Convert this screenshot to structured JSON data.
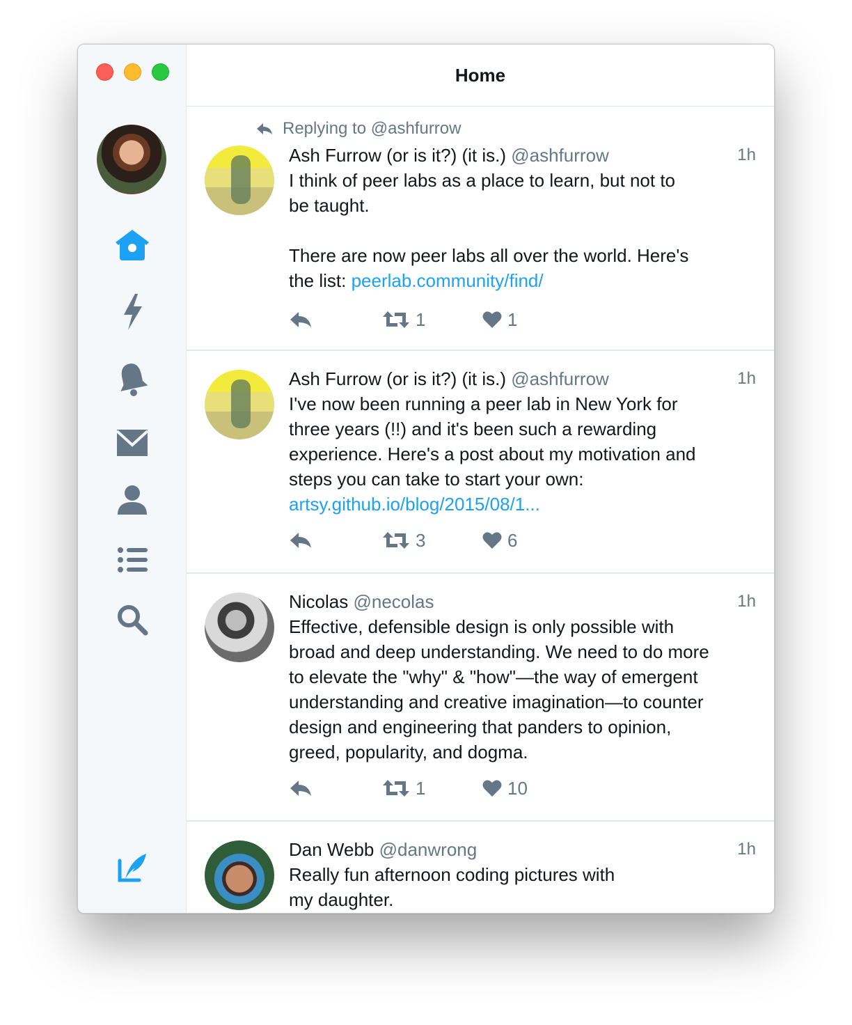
{
  "window": {
    "title": "Home"
  },
  "sidebar": {
    "items": [
      {
        "name": "home",
        "icon": "home-icon",
        "active": true
      },
      {
        "name": "moments",
        "icon": "lightning-icon"
      },
      {
        "name": "notifications",
        "icon": "bell-icon"
      },
      {
        "name": "messages",
        "icon": "envelope-icon"
      },
      {
        "name": "profile",
        "icon": "person-icon"
      },
      {
        "name": "lists",
        "icon": "list-icon"
      },
      {
        "name": "search",
        "icon": "search-icon"
      }
    ],
    "compose_icon": "compose-icon"
  },
  "colors": {
    "accent": "#1da1f2",
    "icon_gray": "#657786",
    "text": "#14171a"
  },
  "tweets": [
    {
      "reply_context": "Replying to @ashfurrow",
      "name": "Ash Furrow (or is it?) (it is.)",
      "handle": "@ashfurrow",
      "time": "1h",
      "text": "I think of peer labs as a place to learn, but not to\nbe taught.\n\nThere are now peer labs all over the world. Here's\nthe list: ",
      "link": "peerlab.community/find/",
      "retweets": "1",
      "likes": "1"
    },
    {
      "name": "Ash Furrow (or is it?) (it is.)",
      "handle": "@ashfurrow",
      "time": "1h",
      "text": "I've now been running a peer lab in New York for\nthree years (!!) and it's been such a rewarding\nexperience. Here's a post about my motivation and\nsteps you can take to start your own:\n",
      "link": "artsy.github.io/blog/2015/08/1...",
      "retweets": "3",
      "likes": "6"
    },
    {
      "name": "Nicolas",
      "handle": "@necolas",
      "time": "1h",
      "text": "Effective, defensible design is only possible with\nbroad and deep understanding. We need to do more\nto elevate the \"why\" & \"how\"—the way of emergent\nunderstanding and creative imagination—to counter\ndesign and engineering that panders to opinion,\ngreed, popularity, and dogma.",
      "retweets": "1",
      "likes": "10"
    },
    {
      "name": "Dan Webb",
      "handle": "@danwrong",
      "time": "1h",
      "text": "Really fun afternoon coding pictures with\nmy daughter."
    }
  ]
}
